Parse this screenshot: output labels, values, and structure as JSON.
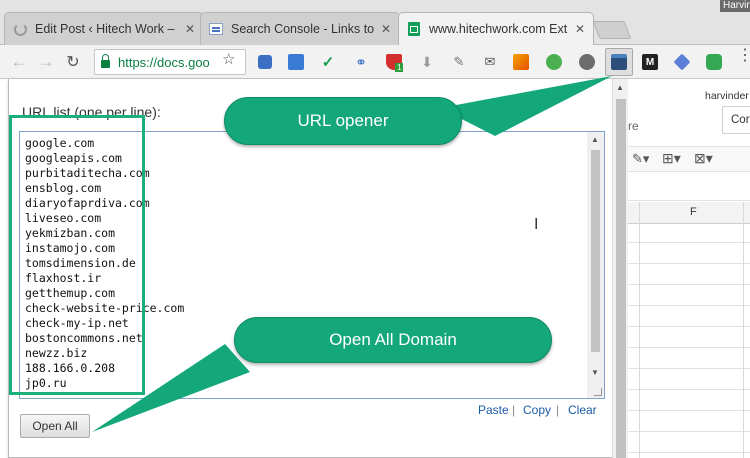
{
  "tabs": [
    {
      "title": "Edit Post ‹ Hitech Work –",
      "close": "✕",
      "favicon": "loading-spinner-icon"
    },
    {
      "title": "Search Console - Links to",
      "close": "✕",
      "favicon": "search-console-icon"
    },
    {
      "title": "www.hitechwork.com Ext",
      "close": "✕",
      "favicon": "sheets-icon",
      "active": true
    }
  ],
  "profile": {
    "name": "Harvir"
  },
  "toolbar": {
    "url": "https://docs.goo",
    "extensions": [
      "keyboard-icon",
      "chart-icon",
      "check-icon",
      "link-icon",
      "shield-icon",
      "download-icon",
      "pencil-icon",
      "mail-icon",
      "analytics-icon",
      "globe-icon",
      "url-opener-icon",
      "medium-icon",
      "tools-icon",
      "frog-icon",
      "puzzle-icon"
    ],
    "extension_badge": "1"
  },
  "sheet": {
    "user": "harvinder",
    "button": "Cor",
    "text": "re",
    "column": "F"
  },
  "popup": {
    "label": "URL list (one per line):",
    "urls": [
      "google.com",
      "googleapis.com",
      "purbitaditecha.com",
      "ensblog.com",
      "diaryofaprdiva.com",
      "liveseo.com",
      "yekmizban.com",
      "instamojo.com",
      "tomsdimension.de",
      "flaxhost.ir",
      "getthemup.com",
      "check-website-price.com",
      "check-my-ip.net",
      "bostoncommons.net",
      "newzz.biz",
      "188.166.0.208",
      "jp0.ru"
    ],
    "actions": {
      "paste": "Paste",
      "copy": "Copy",
      "clear": "Clear",
      "separator": "|"
    },
    "open_all": "Open All"
  },
  "annotations": {
    "url_opener": "URL opener",
    "open_all_domain": "Open All Domain",
    "color": "#14a77a"
  }
}
